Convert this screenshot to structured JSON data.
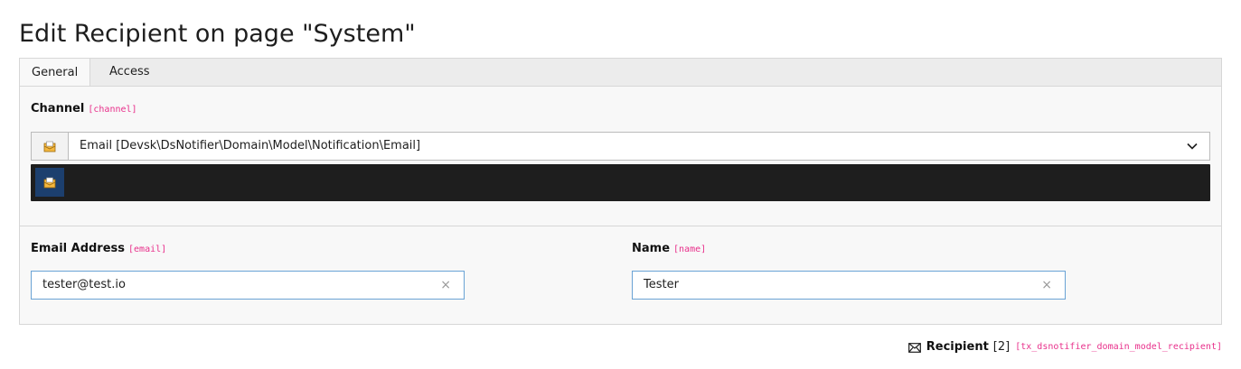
{
  "page": {
    "title": "Edit Recipient on page \"System\""
  },
  "tabs": [
    {
      "label": "General",
      "active": true
    },
    {
      "label": "Access",
      "active": false
    }
  ],
  "fields": {
    "channel": {
      "label": "Channel",
      "key": "[channel]",
      "value": "Email [Devsk\\DsNotifier\\Domain\\Model\\Notification\\Email]",
      "icon": "envelope-open-icon"
    },
    "email": {
      "label": "Email Address",
      "key": "[email]",
      "value": "tester@test.io",
      "clear_glyph": "×"
    },
    "name": {
      "label": "Name",
      "key": "[name]",
      "value": "Tester",
      "clear_glyph": "×"
    }
  },
  "footer": {
    "icon": "envelope-icon",
    "record_title": "Recipient",
    "record_uid": "[2]",
    "table_name": "[tx_dsnotifier_domain_model_recipient]"
  },
  "colors": {
    "accent_pink": "#e8308b",
    "input_border_focus": "#6aa3d5",
    "icon_strip_bg": "#1e1e1e",
    "icon_selected_bg": "#1c3f6e"
  }
}
